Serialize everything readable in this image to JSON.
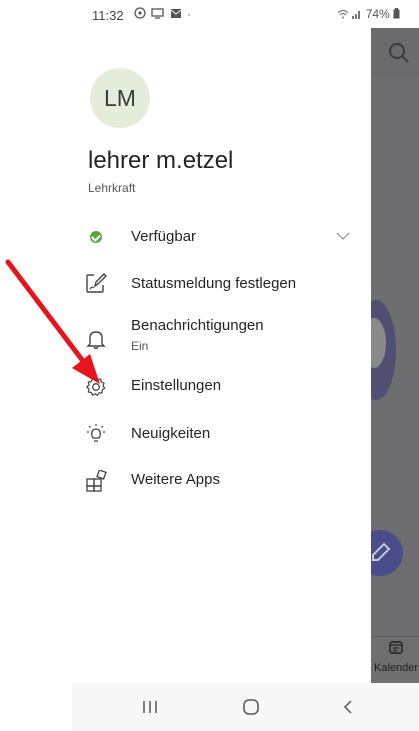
{
  "status_bar": {
    "time": "11:32",
    "notif_icons": [
      "whatsapp-icon",
      "cast-icon",
      "email-icon"
    ],
    "dot": "·",
    "battery": "74%"
  },
  "user": {
    "initials": "LM",
    "name": "lehrer m.etzel",
    "role": "Lehrkraft"
  },
  "menu": [
    {
      "id": "availability",
      "label": "Verfügbar",
      "icon": "available-status-icon",
      "status_color": "#59a53a"
    },
    {
      "id": "status-message",
      "label": "Statusmeldung festlegen",
      "icon": "edit-status-icon"
    },
    {
      "id": "notifications",
      "label": "Benachrichtigungen",
      "sublabel": "Ein",
      "icon": "bell-icon"
    },
    {
      "id": "settings",
      "label": "Einstellungen",
      "icon": "gear-icon"
    },
    {
      "id": "whats-new",
      "label": "Neuigkeiten",
      "icon": "lightbulb-icon"
    },
    {
      "id": "more-apps",
      "label": "Weitere Apps",
      "icon": "apps-icon"
    }
  ],
  "background": {
    "bottom_tab_label": "Kalender",
    "accent": "#4b4d8a"
  },
  "annotation": {
    "color": "#e8141b",
    "target": "Einstellungen"
  }
}
